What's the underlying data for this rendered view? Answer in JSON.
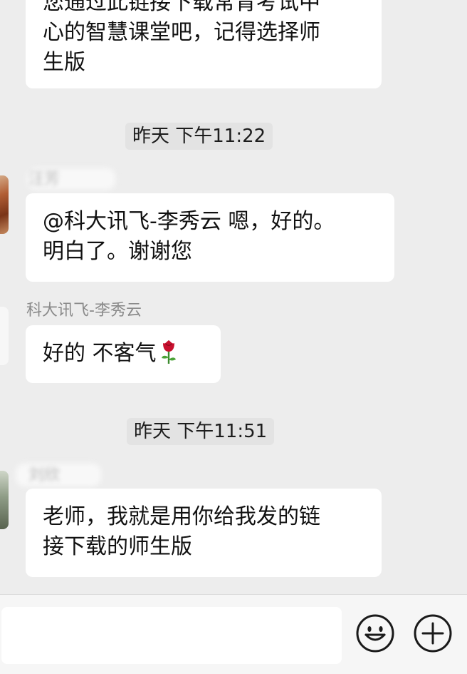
{
  "messages": [
    {
      "text_lines": [
        "您通过此链接下载常青考试中",
        "心的智慧课堂吧，记得选择师",
        "生版"
      ]
    },
    {
      "sender_name": "汪芳",
      "text_lines": [
        "@科大讯飞-李秀云 嗯，好的。",
        "明白了。谢谢您"
      ]
    },
    {
      "sender_name": "科大讯飞-李秀云",
      "text": "好的 不客气"
    },
    {
      "sender_name": "刘欣",
      "text_lines": [
        "老师，我就是用你给我发的链",
        "接下载的师生版"
      ]
    }
  ],
  "timestamps": [
    "昨天 下午11:22",
    "昨天 下午11:51"
  ],
  "icons": {
    "flower": "rose-emoji",
    "emoji_button": "smiley-face-icon",
    "more_button": "plus-circle-icon"
  },
  "input": {
    "value": "",
    "placeholder": ""
  },
  "colors": {
    "background": "#ededed",
    "bubble": "#ffffff",
    "rose": "#c8102e"
  }
}
